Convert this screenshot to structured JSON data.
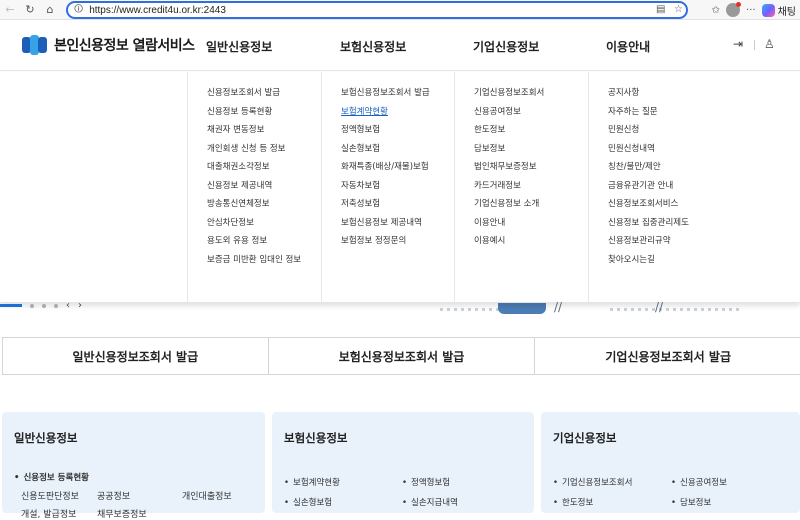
{
  "browser": {
    "url": "https://www.credit4u.or.kr:2443",
    "copilot_label": "채팅"
  },
  "header": {
    "logo_text": "본인신용정보 열람서비스",
    "gnb": [
      "일반신용정보",
      "보험신용정보",
      "기업신용정보",
      "이용안내"
    ]
  },
  "mega_menu": {
    "general": [
      "신용정보조회서 발급",
      "신용정보 등록현황",
      "채권자 변동정보",
      "개인회생 신청 등 정보",
      "대출채권소각정보",
      "신용정보 제공내역",
      "방송통신연체정보",
      "안심차단정보",
      "용도외 유용 정보",
      "보증금 미반환 임대인 정보"
    ],
    "insurance": [
      "보험신용정보조회서 발급",
      "보험계약현황",
      "정액형보험",
      "실손형보험",
      "화재특종(배상/재물)보험",
      "자동차보험",
      "저축성보험",
      "보험신용정보 제공내역",
      "보험정보 정정문의"
    ],
    "corporate": [
      "기업신용정보조회서",
      "신용공여정보",
      "한도정보",
      "담보정보",
      "법인채무보증정보",
      "카드거래정보",
      "기업신용정보 소개",
      "이용안내",
      "이용예시"
    ],
    "guide": [
      "공지사항",
      "자주하는 질문",
      "민원신청",
      "민원신청내역",
      "칭찬/불만/제안",
      "금융유관기관 안내",
      "신용정보조회서비스",
      "신용정보 집중관리제도",
      "신용정보관리규약",
      "찾아오시는길"
    ]
  },
  "issue_buttons": [
    "일반신용정보조회서 발급",
    "보험신용정보조회서 발급",
    "기업신용정보조회서 발급"
  ],
  "cards": {
    "general": {
      "title": "일반신용정보",
      "items": [
        "신용정보 등록현황",
        "신용도판단정보",
        "공공정보",
        "개인대출정보",
        "개설, 발급정보",
        "채무보증정보"
      ]
    },
    "insurance": {
      "title": "보험신용정보",
      "items": [
        "보험계약현황",
        "정액형보험",
        "실손형보험",
        "실손지급내역"
      ]
    },
    "corporate": {
      "title": "기업신용정보",
      "items": [
        "기업신용정보조회서",
        "신용공여정보",
        "한도정보",
        "담보정보"
      ]
    }
  }
}
